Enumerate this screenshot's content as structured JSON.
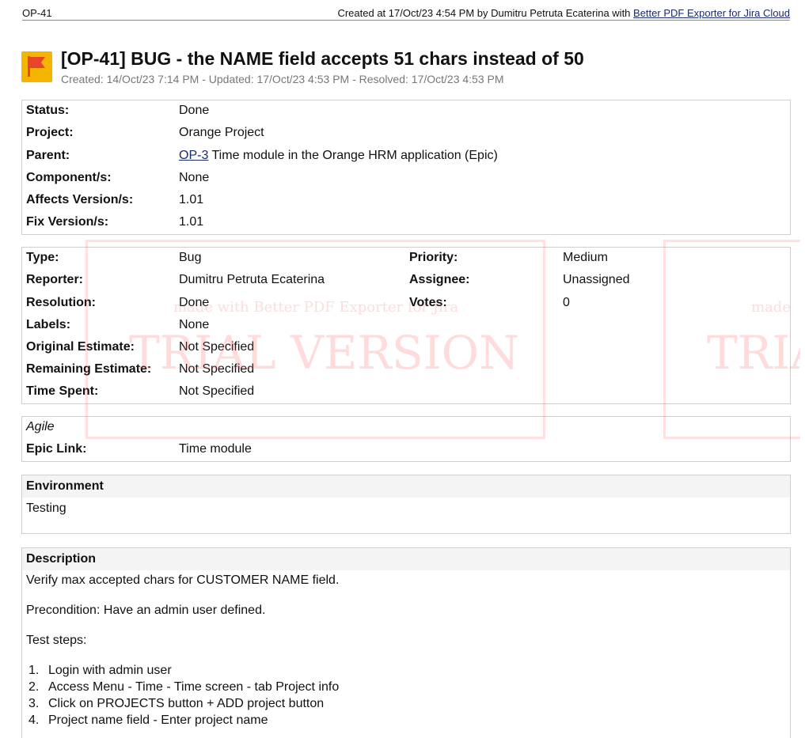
{
  "header": {
    "issue_key": "OP-41",
    "created_prefix": "Created at 17/Oct/23 4:54 PM by Dumitru Petruta Ecaterina with ",
    "exporter_link": "Better PDF Exporter for Jira Cloud"
  },
  "issue": {
    "title": "[OP-41] BUG - the NAME field accepts 51 chars instead of 50",
    "subtitle": "Created: 14/Oct/23 7:14 PM - Updated: 17/Oct/23 4:53 PM - Resolved: 17/Oct/23 4:53 PM",
    "icon": "bug-flag-icon",
    "icon_color": "#f5b400",
    "icon_flag_color": "#e8452c"
  },
  "general": {
    "status_label": "Status:",
    "status_value": "Done",
    "project_label": "Project:",
    "project_value": "Orange Project",
    "parent_label": "Parent:",
    "parent_key": "OP-3",
    "parent_text": " Time module in the Orange HRM application (Epic)",
    "component_label": "Component/s:",
    "component_value": "None",
    "affects_label": "Affects Version/s:",
    "affects_value": "1.01",
    "fix_label": "Fix Version/s:",
    "fix_value": "1.01"
  },
  "details": {
    "type_label": "Type:",
    "type_value": "Bug",
    "priority_label": "Priority:",
    "priority_value": "Medium",
    "reporter_label": "Reporter:",
    "reporter_value": "Dumitru Petruta Ecaterina",
    "assignee_label": "Assignee:",
    "assignee_value": "Unassigned",
    "resolution_label": "Resolution:",
    "resolution_value": "Done",
    "votes_label": "Votes:",
    "votes_value": "0",
    "labels_label": "Labels:",
    "labels_value": "None",
    "orig_est_label": "Original Estimate:",
    "orig_est_value": "Not Specified",
    "rem_est_label": "Remaining Estimate:",
    "rem_est_value": "Not Specified",
    "time_spent_label": "Time Spent:",
    "time_spent_value": "Not Specified"
  },
  "agile": {
    "heading": "Agile",
    "epic_label": "Epic Link:",
    "epic_value": "Time module"
  },
  "environment": {
    "heading": "Environment",
    "value": "Testing"
  },
  "description": {
    "heading": "Description",
    "line1": "Verify max accepted chars for CUSTOMER NAME field.",
    "line2": "Precondition: Have an admin user defined.",
    "line3": "Test steps:",
    "steps": [
      {
        "num": "1.",
        "text": "Login with admin user"
      },
      {
        "num": "2.",
        "text": "Access Menu - Time - Time screen - tab Project info"
      },
      {
        "num": "3.",
        "text": "Click on PROJECTS button + ADD project button"
      },
      {
        "num": "4.",
        "text": "Project name field - Enter project name"
      }
    ]
  },
  "watermark": {
    "small_text": "made with Better PDF Exporter for Jira",
    "big_text": "TRIAL VERSION",
    "small_text_right": "made",
    "big_text_right": "TRIA",
    "color": "#ff5a5a"
  }
}
